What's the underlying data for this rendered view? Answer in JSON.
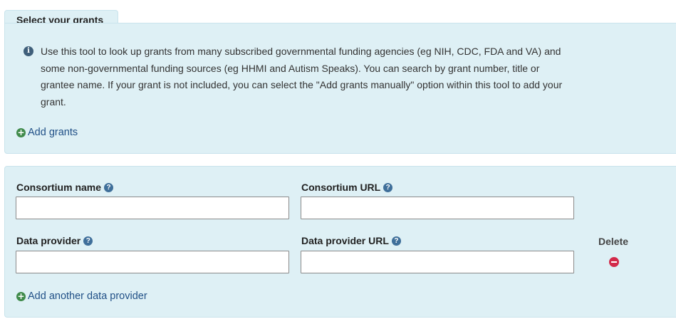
{
  "grants": {
    "tab_title": "Select your grants",
    "info_text": "Use this tool to look up grants from many subscribed governmental funding agencies (eg NIH, CDC, FDA and VA) and some non-governmental funding sources (eg HHMI and Autism Speaks). You can search by grant number, title or grantee name. If your grant is not included, you can select the \"Add grants manually\" option within this tool to add your grant.",
    "add_link": "Add grants",
    "info_icon": "info-icon",
    "add_icon": "plus-circle-icon"
  },
  "provider": {
    "consortium_name_label": "Consortium name",
    "consortium_name_value": "",
    "consortium_url_label": "Consortium URL",
    "consortium_url_value": "",
    "data_provider_label": "Data provider",
    "data_provider_value": "",
    "data_provider_url_label": "Data provider URL",
    "data_provider_url_value": "",
    "delete_label": "Delete",
    "add_link": "Add another data provider",
    "help_icon": "question-circle-icon",
    "delete_icon": "minus-circle-icon"
  },
  "colors": {
    "panel_bg": "#def0f5",
    "link": "#1f4f86",
    "add_icon": "#3f8a4a",
    "delete_icon": "#d22a4a"
  }
}
